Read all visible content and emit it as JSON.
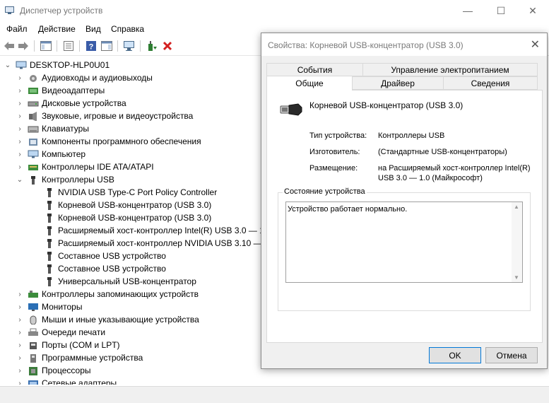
{
  "window": {
    "title": "Диспетчер устройств",
    "minimize_glyph": "—",
    "maximize_glyph": "☐",
    "close_glyph": "✕"
  },
  "menu": [
    "Файл",
    "Действие",
    "Вид",
    "Справка"
  ],
  "tree": {
    "root": "DESKTOP-HLP0U01",
    "categories": [
      {
        "label": "Аудиовходы и аудиовыходы",
        "icon": "audio-icon"
      },
      {
        "label": "Видеоадаптеры",
        "icon": "display-adapter-icon"
      },
      {
        "label": "Дисковые устройства",
        "icon": "disk-icon"
      },
      {
        "label": "Звуковые, игровые и видеоустройства",
        "icon": "sound-icon"
      },
      {
        "label": "Клавиатуры",
        "icon": "keyboard-icon"
      },
      {
        "label": "Компоненты программного обеспечения",
        "icon": "software-component-icon"
      },
      {
        "label": "Компьютер",
        "icon": "computer-icon"
      },
      {
        "label": "Контроллеры IDE ATA/ATAPI",
        "icon": "ide-controller-icon"
      },
      {
        "label": "Контроллеры USB",
        "icon": "usb-icon",
        "expanded": true
      }
    ],
    "usb_children": [
      "NVIDIA USB Type-C Port Policy Controller",
      "Корневой USB-концентратор (USB 3.0)",
      "Корневой USB-концентратор (USB 3.0)",
      "Расширяемый хост-контроллер Intel(R) USB 3.0 — 1.",
      "Расширяемый хост-контроллер NVIDIA USB 3.10 — ",
      "Составное USB устройство",
      "Составное USB устройство",
      "Универсальный USB-концентратор"
    ],
    "categories_after": [
      {
        "label": "Контроллеры запоминающих устройств",
        "icon": "storage-controller-icon"
      },
      {
        "label": "Мониторы",
        "icon": "monitor-icon"
      },
      {
        "label": "Мыши и иные указывающие устройства",
        "icon": "mouse-icon"
      },
      {
        "label": "Очереди печати",
        "icon": "printer-icon"
      },
      {
        "label": "Порты (COM и LPT)",
        "icon": "port-icon"
      },
      {
        "label": "Программные устройства",
        "icon": "software-device-icon"
      },
      {
        "label": "Процессоры",
        "icon": "processor-icon"
      },
      {
        "label": "Сетевые адаптеры",
        "icon": "network-adapter-icon"
      }
    ]
  },
  "dialog": {
    "title": "Свойства: Корневой USB-концентратор (USB 3.0)",
    "tabs_back": [
      "События",
      "Управление электропитанием"
    ],
    "tabs_front": [
      "Общие",
      "Драйвер",
      "Сведения"
    ],
    "device_name": "Корневой USB-концентратор (USB 3.0)",
    "fields": {
      "type_label": "Тип устройства:",
      "type_value": "Контроллеры USB",
      "maker_label": "Изготовитель:",
      "maker_value": "(Стандартные USB-концентраторы)",
      "location_label": "Размещение:",
      "location_value_line1": "на Расширяемый хост-контроллер Intel(R)",
      "location_value_line2": "USB 3.0 — 1.0 (Майкрософт)"
    },
    "status_group_label": "Состояние устройства",
    "status_text": "Устройство работает нормально.",
    "ok_label": "OK",
    "cancel_label": "Отмена"
  },
  "colors": {
    "accent": "#0078d7",
    "usb_icon": "#333333"
  }
}
